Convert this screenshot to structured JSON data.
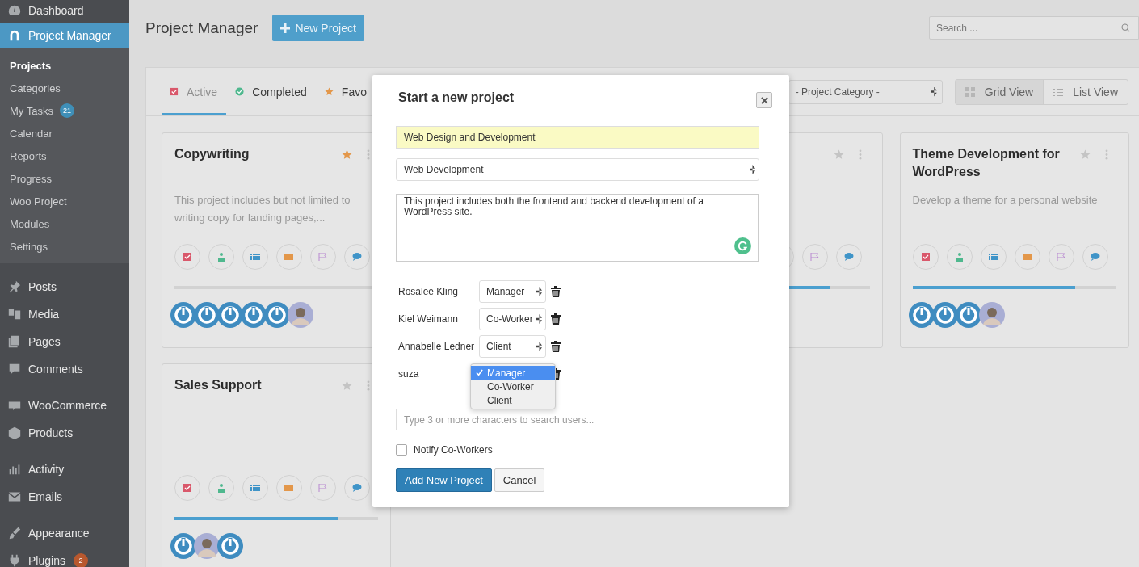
{
  "sidebar": {
    "groups": [
      {
        "items": [
          {
            "label": "Dashboard",
            "selected": false
          },
          {
            "label": "Project Manager",
            "selected": true,
            "children": [
              {
                "label": "Projects",
                "selected": true
              },
              {
                "label": "Categories",
                "selected": false
              },
              {
                "label": "My Tasks",
                "selected": false,
                "badge": {
                  "text": "21",
                  "color": "#3f8fb8"
                }
              },
              {
                "label": "Calendar",
                "selected": false
              },
              {
                "label": "Reports",
                "selected": false
              },
              {
                "label": "Progress",
                "selected": false
              },
              {
                "label": "Woo Project",
                "selected": false
              },
              {
                "label": "Modules",
                "selected": false
              },
              {
                "label": "Settings",
                "selected": false
              }
            ]
          }
        ]
      },
      {
        "items": [
          {
            "label": "Posts",
            "selected": false
          },
          {
            "label": "Media",
            "selected": false
          },
          {
            "label": "Pages",
            "selected": false
          },
          {
            "label": "Comments",
            "selected": false
          }
        ]
      },
      {
        "items": [
          {
            "label": "WooCommerce",
            "selected": false
          },
          {
            "label": "Products",
            "selected": false
          }
        ]
      },
      {
        "items": [
          {
            "label": "Activity",
            "selected": false
          },
          {
            "label": "Emails",
            "selected": false
          }
        ]
      },
      {
        "items": [
          {
            "label": "Appearance",
            "selected": false
          },
          {
            "label": "Plugins",
            "selected": false,
            "badge": {
              "text": "2",
              "color": "#b8582e"
            }
          }
        ]
      }
    ]
  },
  "header": {
    "title": "Project Manager",
    "new_project_button": "New Project",
    "search": {
      "placeholder": "Search ..."
    }
  },
  "tabs": [
    {
      "label": "Active",
      "selected": true
    },
    {
      "label": "Completed",
      "selected": false
    },
    {
      "label": "Favo",
      "selected": false
    }
  ],
  "category_filter": {
    "value": "- Project Category -"
  },
  "view_toggle": [
    {
      "label": "Grid View",
      "selected": true
    },
    {
      "label": "List View",
      "selected": false
    }
  ],
  "cards": [
    {
      "title": "Copywriting",
      "description": "This project includes but not limited to writing copy for landing pages,...",
      "favorite": true,
      "level": 0,
      "avatars": [
        {
          "kind": "default"
        },
        {
          "kind": "default"
        },
        {
          "kind": "default"
        },
        {
          "kind": "default"
        },
        {
          "kind": "default"
        },
        {
          "kind": "photo"
        }
      ]
    },
    {
      "favorite": false,
      "level": 0.8
    },
    {
      "title": "Theme Development for WordPress",
      "description": "Develop a theme for a personal website",
      "favorite": false,
      "level": 0.8,
      "avatars": [
        {
          "kind": "default"
        },
        {
          "kind": "default"
        },
        {
          "kind": "default"
        },
        {
          "kind": "photo"
        }
      ]
    },
    {
      "title": "Sales Support",
      "favorite": false,
      "level": 0.8,
      "avatars": [
        {
          "kind": "default"
        },
        {
          "kind": "photo"
        },
        {
          "kind": "default"
        }
      ]
    }
  ],
  "modal": {
    "title": "Start a new project",
    "name_field": {
      "value": "Web Design and Development"
    },
    "category_select": {
      "value": "Web Development"
    },
    "description": {
      "value": "This project includes both the frontend and backend development of a WordPress site."
    },
    "members": [
      {
        "name": "Rosalee Kling",
        "role": "Manager"
      },
      {
        "name": "Kiel Weimann",
        "role": "Co-Worker"
      },
      {
        "name": "Annabelle Ledner",
        "role": "Client"
      },
      {
        "name": "suza",
        "dropdown": [
          {
            "label": "Manager",
            "selected": true
          },
          {
            "label": "Co-Worker",
            "selected": false
          },
          {
            "label": "Client",
            "selected": false
          }
        ]
      }
    ],
    "user_search": {
      "placeholder": "Type 3 or more characters to search users..."
    },
    "notify": {
      "label": "Notify Co-Workers",
      "checked": false
    },
    "submit_button": "Add New Project",
    "cancel_button": "Cancel"
  }
}
